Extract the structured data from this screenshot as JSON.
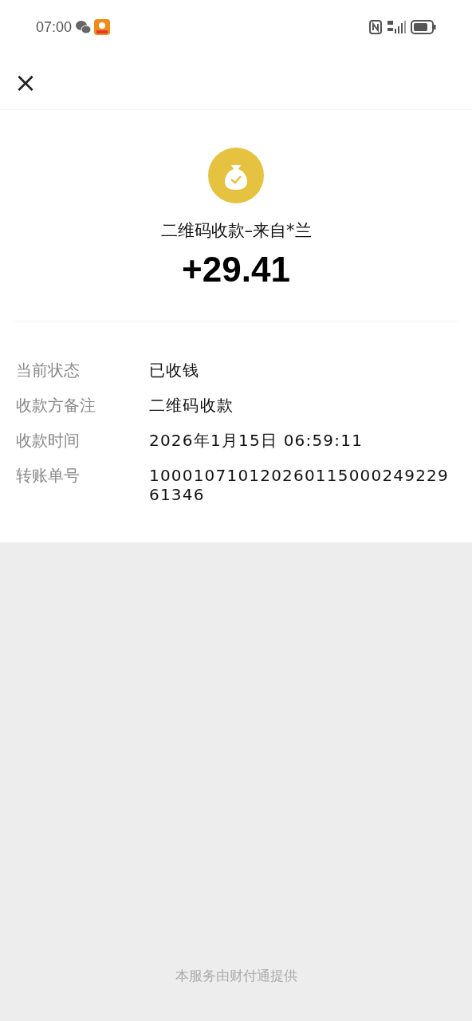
{
  "status_bar": {
    "time": "07:00"
  },
  "header": {
    "close": "×"
  },
  "summary": {
    "title": "二维码收款–来自*兰",
    "amount": "+29.41"
  },
  "details": [
    {
      "label": "当前状态",
      "value": "已收钱"
    },
    {
      "label": "收款方备注",
      "value": "二维码收款"
    },
    {
      "label": "收款时间",
      "value": "2026年1月15日 06:59:11"
    },
    {
      "label": "转账单号",
      "value": "10001071012026011500024922961346"
    }
  ],
  "footer": "本服务由财付通提供"
}
